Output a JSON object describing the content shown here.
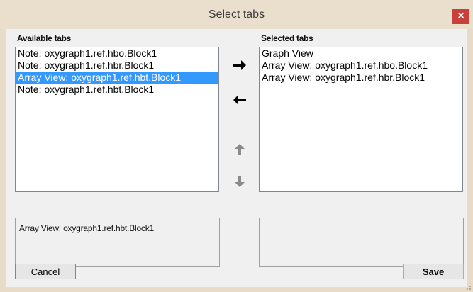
{
  "window": {
    "title": "Select tabs",
    "close_glyph": "×"
  },
  "available": {
    "label": "Available tabs",
    "items": [
      {
        "label": "Note: oxygraph1.ref.hbo.Block1",
        "selected": false
      },
      {
        "label": "Note: oxygraph1.ref.hbr.Block1",
        "selected": false
      },
      {
        "label": "Array View: oxygraph1.ref.hbt.Block1",
        "selected": true
      },
      {
        "label": "Note: oxygraph1.ref.hbt.Block1",
        "selected": false
      }
    ],
    "info_text": "Array View: oxygraph1.ref.hbt.Block1"
  },
  "selected": {
    "label": "Selected tabs",
    "items": [
      {
        "label": "Graph View"
      },
      {
        "label": "Array View: oxygraph1.ref.hbo.Block1"
      },
      {
        "label": "Array View: oxygraph1.ref.hbr.Block1"
      }
    ],
    "info_text": ""
  },
  "buttons": {
    "cancel_label": "Cancel",
    "save_label": "Save"
  },
  "icons": {
    "move_right": "arrow-right-icon",
    "move_left": "arrow-left-icon",
    "move_up": "arrow-up-icon",
    "move_down": "arrow-down-icon"
  },
  "colors": {
    "selection": "#3399ff",
    "close_button": "#c8403a",
    "window_frame": "#eadfcc"
  }
}
